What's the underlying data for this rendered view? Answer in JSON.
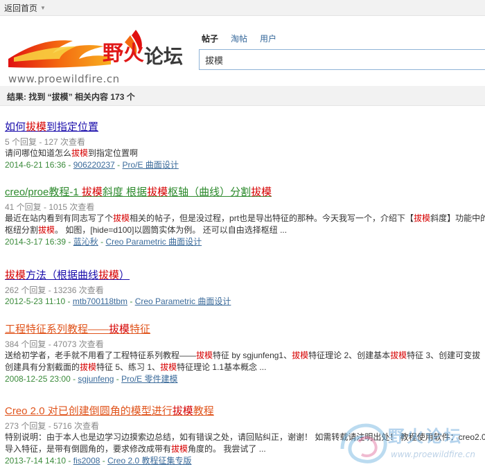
{
  "topbar": {
    "back_label": "返回首页"
  },
  "logo": {
    "name_part1": "野火",
    "name_part2": "论坛",
    "url": "www.proewildfire.cn"
  },
  "tabs": [
    {
      "label": "帖子"
    },
    {
      "label": "淘帖"
    },
    {
      "label": "用户"
    }
  ],
  "search": {
    "value": "拔模"
  },
  "results": {
    "prefix": "结果: 找到 “",
    "keyword": "拔模",
    "suffix": "” 相关内容 173 个"
  },
  "items": [
    {
      "title": [
        "如何",
        "拔模",
        "到指定位置"
      ],
      "title_color": "#1a0dab",
      "meta": "5 个回复 - 127 次查看",
      "snippet": [
        [
          "请问哪位知道怎么",
          false
        ],
        [
          "拔模",
          true
        ],
        [
          "到指定位置啊",
          false
        ]
      ],
      "snippet2": [],
      "date": "2014-6-21 16:36",
      "author": "906220237",
      "forum": "Pro/E 曲面设计"
    },
    {
      "title": [
        "creo/proe教程-1 ",
        "拔模",
        "斜度 根据",
        "拔模",
        "枢轴（曲线）分割",
        "拔模"
      ],
      "title_color": "#2d8a2d",
      "meta": "41 个回复 - 1015 次查看",
      "snippet": [
        [
          "最近在站内看到有同志写了个",
          false
        ],
        [
          "拔模",
          true
        ],
        [
          "相关的帖子，但是没过程，prt也是导出特征的那种。今天我写一个，介绍下【",
          false
        ],
        [
          "拔模",
          true
        ],
        [
          "斜度】功能中的",
          false
        ]
      ],
      "snippet2": [
        [
          "枢纽分割",
          false
        ],
        [
          "拔模",
          true
        ],
        [
          "。 如图，[hide=d100]以圆筒实体为例。 还可以自由选择枢纽 ...",
          false
        ]
      ],
      "date": "2014-3-17 16:39",
      "author": "蓝沁秋",
      "forum": "Creo Parametric 曲面设计"
    },
    {
      "title": [
        "拔模",
        "方法（根据曲线",
        "拔模",
        "）"
      ],
      "title_color": "#1a0dab",
      "meta": "262 个回复 - 13236 次查看",
      "snippet": [],
      "snippet2": [],
      "date": "2012-5-23 11:10",
      "author": "mtb700118tbm",
      "forum": "Creo Parametric 曲面设计"
    },
    {
      "title": [
        "工程特征系列教程——",
        "拔模",
        "特征"
      ],
      "title_color": "#e0541c",
      "meta": "384 个回复 - 47073 次查看",
      "snippet": [
        [
          "送给初学者，老手就不用看了工程特征系列教程——",
          false
        ],
        [
          "拔模",
          true
        ],
        [
          "特征 by sgjunfeng1、",
          false
        ],
        [
          "拔模",
          true
        ],
        [
          "特征理论 2、创建基本",
          false
        ],
        [
          "拔模",
          true
        ],
        [
          "特征 3、创建可变拔",
          false
        ]
      ],
      "snippet2": [
        [
          "创建具有分割截面的",
          false
        ],
        [
          "拔模",
          true
        ],
        [
          "特征 5、练习 1、",
          false
        ],
        [
          "拔模",
          true
        ],
        [
          "特征理论 1.1基本概念 ...",
          false
        ]
      ],
      "date": "2008-12-25 23:00",
      "author": "sgjunfeng",
      "forum": "Pro/E 零件建模"
    },
    {
      "title": [
        "Creo 2.0 对已创建倒圆角的模型进行",
        "拔模",
        "教程"
      ],
      "title_color": "#e0541c",
      "meta": "273 个回复 - 5716 次查看",
      "snippet": [
        [
          "特别说明：由于本人也是边学习边摸索边总结，如有错误之处，请回贴纠正，谢谢！ 如需转载请注明出处！ 教程使用软件：creo2.0",
          false
        ]
      ],
      "snippet2": [
        [
          "导入特征，是带有倒圆角的，要求修改成带有",
          false
        ],
        [
          "拔模",
          true
        ],
        [
          "角度的。 我尝试了 ...",
          false
        ]
      ],
      "date": "2013-7-14 14:10",
      "author": "fis2008",
      "forum": "Creo 2.0 教程征集专版"
    }
  ],
  "watermark": {
    "text": "野火论坛",
    "url": "www.proewildfire.cn"
  },
  "colors": {
    "highlight": "#d60000",
    "link": "#1a0dab",
    "accent_orange": "#e0541c",
    "green": "#2d8a2d"
  }
}
